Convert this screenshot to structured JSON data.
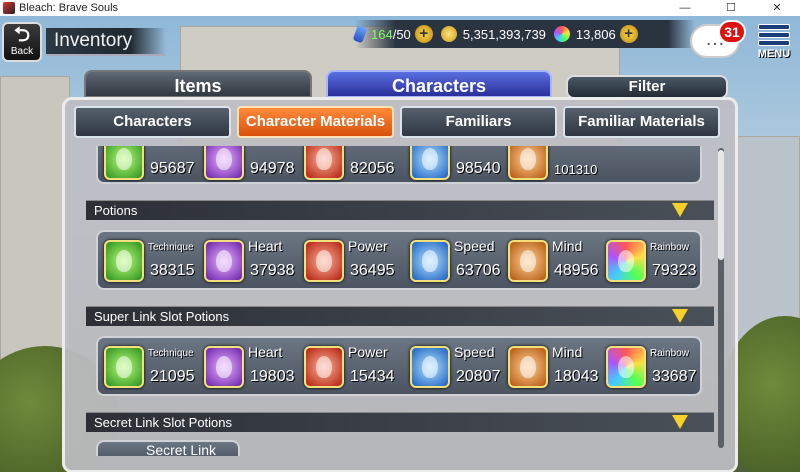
{
  "window": {
    "title": "Bleach: Brave Souls",
    "minimize": "—",
    "maximize": "☐",
    "close": "✕"
  },
  "topbar": {
    "back_arrow": "⮌",
    "back_label": "Back",
    "page_title": "Inventory",
    "stamina_current": "164",
    "stamina_max": "/50",
    "coins": "5,351,393,739",
    "spirit_orbs": "13,806",
    "mail_count": "31",
    "mail_icon": "…",
    "menu_label": "MENU"
  },
  "main_tabs": {
    "items": "Items",
    "characters": "Characters",
    "filter": "Filter"
  },
  "sub_tabs": [
    "Characters",
    "Character Materials",
    "Familiars",
    "Familiar Materials"
  ],
  "top_row": [
    {
      "color": "tech",
      "count": "95687"
    },
    {
      "color": "heart",
      "count": "94978"
    },
    {
      "color": "power",
      "count": "82056"
    },
    {
      "color": "speed",
      "count": "98540"
    },
    {
      "color": "mind",
      "count": "101310"
    }
  ],
  "sections": [
    {
      "title": "Potions",
      "items": [
        {
          "name": "Technique",
          "count": "38315",
          "color": "tech"
        },
        {
          "name": "Heart",
          "count": "37938",
          "color": "heart"
        },
        {
          "name": "Power",
          "count": "36495",
          "color": "power"
        },
        {
          "name": "Speed",
          "count": "63706",
          "color": "speed"
        },
        {
          "name": "Mind",
          "count": "48956",
          "color": "mind"
        },
        {
          "name": "Rainbow",
          "count": "79323",
          "color": "rainbow"
        }
      ]
    },
    {
      "title": "Super Link Slot Potions",
      "items": [
        {
          "name": "Technique",
          "count": "21095",
          "color": "tech"
        },
        {
          "name": "Heart",
          "count": "19803",
          "color": "heart"
        },
        {
          "name": "Power",
          "count": "15434",
          "color": "power"
        },
        {
          "name": "Speed",
          "count": "20807",
          "color": "speed"
        },
        {
          "name": "Mind",
          "count": "18043",
          "color": "mind"
        },
        {
          "name": "Rainbow",
          "count": "33687",
          "color": "rainbow"
        }
      ]
    },
    {
      "title": "Secret Link Slot Potions",
      "partial_item": "Secret Link"
    }
  ]
}
